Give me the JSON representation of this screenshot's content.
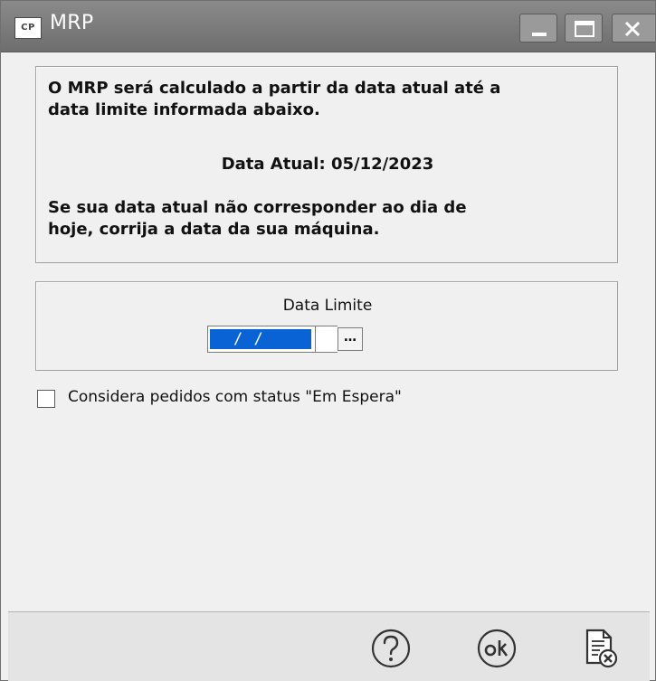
{
  "window": {
    "icon_text": "CP",
    "title": "MRP"
  },
  "info": {
    "line1": "O MRP será calculado a partir da data atual até a",
    "line2": "data limite informada abaixo.",
    "current_date": "Data Atual: 05/12/2023",
    "line3": "Se sua data atual não corresponder ao dia de",
    "line4": "hoje, corrija a data da sua máquina."
  },
  "date_limit": {
    "label": "Data Limite",
    "value": "/ /",
    "picker_label": "…"
  },
  "options": {
    "waiting_orders_label": "Considera pedidos com status \"Em Espera\"",
    "waiting_orders_checked": false
  },
  "footer": {
    "help_icon": "help-circle-icon",
    "ok_icon": "ok-circle-icon",
    "cancel_icon": "document-cancel-icon"
  }
}
